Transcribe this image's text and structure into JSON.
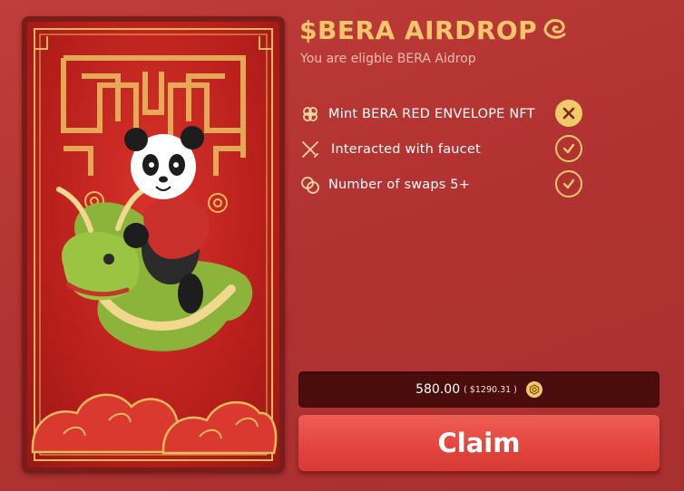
{
  "airdrop": {
    "title": "$BERA AIRDROP",
    "subtitle": "You are eligble BERA Aidrop"
  },
  "tasks": [
    {
      "label": "Mint BERA RED ENVELOPE NFT",
      "icon": "envelope-clover-icon",
      "status": "incomplete"
    },
    {
      "label": "Interacted with faucet",
      "icon": "crossed-swords-icon",
      "status": "complete"
    },
    {
      "label": "Number of swaps 5+",
      "icon": "coins-icon",
      "status": "complete"
    }
  ],
  "reward": {
    "amount": "580.00",
    "usd_value": "( $1290.31 )",
    "token_icon": "bera-token-icon"
  },
  "claim": {
    "label": "Claim"
  },
  "colors": {
    "background": "#b23331",
    "gold": "#f2c96a",
    "claim_button": "#e2443d",
    "amount_bar": "#4a0d0c"
  }
}
